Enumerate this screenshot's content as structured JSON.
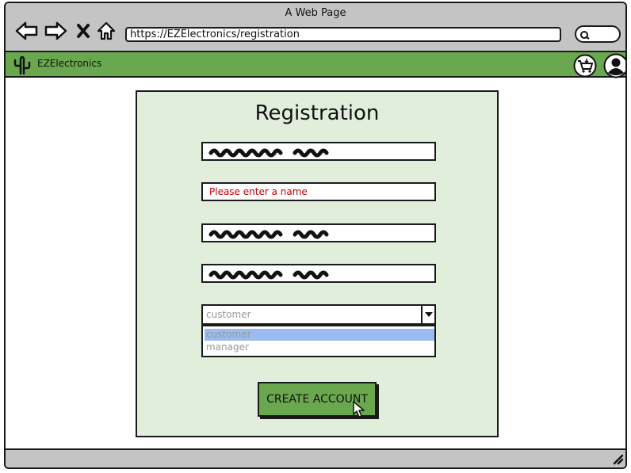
{
  "browser": {
    "window_title": "A Web Page",
    "url": "https://EZElectronics/registration",
    "icons": [
      "back-arrow-icon",
      "forward-arrow-icon",
      "close-icon",
      "home-icon",
      "search-icon"
    ]
  },
  "app": {
    "brand": "EZElectronics",
    "icons": [
      "cactus-logo-icon",
      "cart-icon",
      "user-icon"
    ],
    "accent_color": "#6aa84f",
    "panel_color": "#e1eedb"
  },
  "form": {
    "title": "Registration",
    "fields": [
      {
        "kind": "scribble-placeholder"
      },
      {
        "error": "Please enter a name"
      },
      {
        "kind": "scribble-placeholder"
      },
      {
        "kind": "scribble-placeholder"
      }
    ],
    "role_select": {
      "value": "customer",
      "options": [
        "customer",
        "manager"
      ],
      "highlighted": "customer"
    },
    "submit_label": "CREATE ACCOUNT"
  }
}
